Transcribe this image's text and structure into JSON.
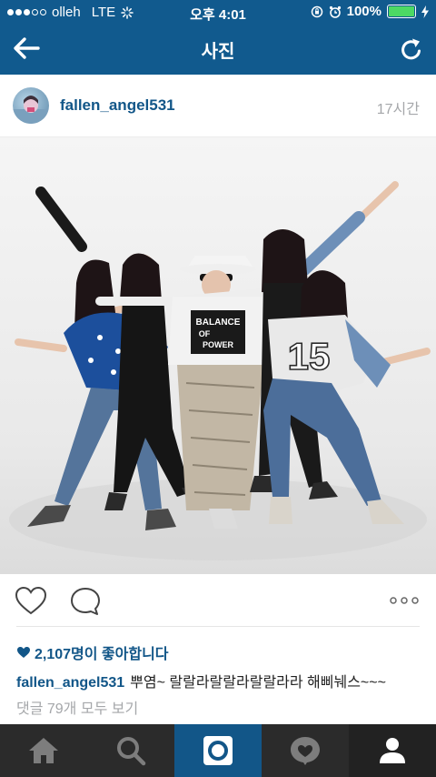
{
  "status_bar": {
    "carrier": "olleh",
    "network": "LTE",
    "time": "오후 4:01",
    "battery": "100%"
  },
  "nav": {
    "title": "사진"
  },
  "post": {
    "username": "fallen_angel531",
    "time_ago": "17시간",
    "shirt_text": [
      "BALANCE",
      "OF",
      "POWER"
    ],
    "jersey_number": "15",
    "likes": "2,107명이 좋아합니다",
    "caption_user": "fallen_angel531",
    "caption_text": "뿌염~ 랄랄라랄랄라랄랄라라 해삐눼스~~~",
    "comments_link": "댓글 79개 모두 보기"
  },
  "tabs": [
    {
      "name": "home-tab",
      "icon": "home-icon"
    },
    {
      "name": "search-tab",
      "icon": "search-icon"
    },
    {
      "name": "camera-tab",
      "icon": "camera-icon"
    },
    {
      "name": "activity-tab",
      "icon": "activity-heart-icon"
    },
    {
      "name": "profile-tab",
      "icon": "profile-icon"
    }
  ],
  "colors": {
    "brand": "#115a8e",
    "link": "#125688",
    "muted": "#a5a7aa",
    "tab_bg": "#2b2b2b",
    "battery": "#4cd964"
  }
}
